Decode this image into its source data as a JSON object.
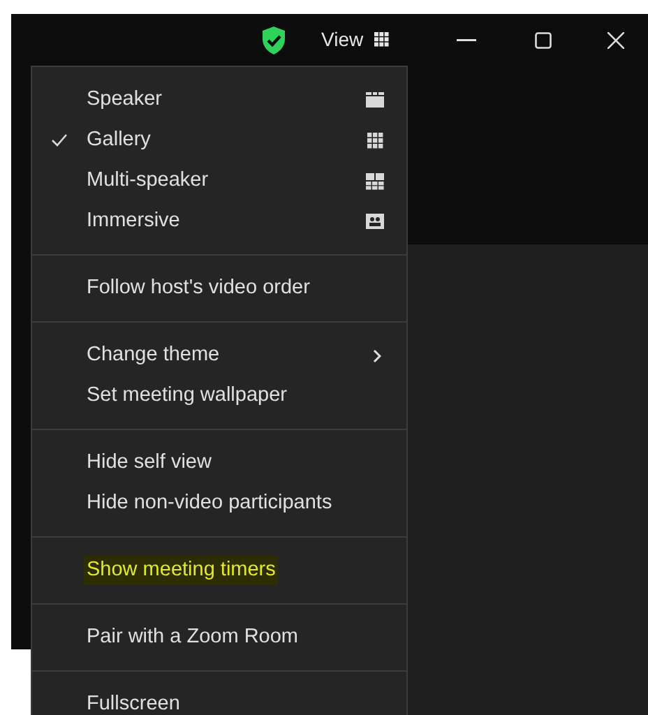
{
  "title_bar": {
    "view_label": "View"
  },
  "menu": {
    "groups": [
      [
        {
          "label": "Speaker",
          "checked": false,
          "kind": "speaker",
          "submenu": false,
          "highlighted": false
        },
        {
          "label": "Gallery",
          "checked": true,
          "kind": "gallery",
          "submenu": false,
          "highlighted": false
        },
        {
          "label": "Multi-speaker",
          "checked": false,
          "kind": "multi",
          "submenu": false,
          "highlighted": false
        },
        {
          "label": "Immersive",
          "checked": false,
          "kind": "immersive",
          "submenu": false,
          "highlighted": false
        }
      ],
      [
        {
          "label": "Follow host's video order",
          "checked": false,
          "submenu": false,
          "highlighted": false
        }
      ],
      [
        {
          "label": "Change theme",
          "checked": false,
          "submenu": true,
          "highlighted": false
        },
        {
          "label": "Set meeting wallpaper",
          "checked": false,
          "submenu": false,
          "highlighted": false
        }
      ],
      [
        {
          "label": "Hide self view",
          "checked": false,
          "submenu": false,
          "highlighted": false
        },
        {
          "label": "Hide non-video participants",
          "checked": false,
          "submenu": false,
          "highlighted": false
        }
      ],
      [
        {
          "label": "Show meeting timers",
          "checked": false,
          "submenu": false,
          "highlighted": true
        }
      ],
      [
        {
          "label": "Pair with a Zoom Room",
          "checked": false,
          "submenu": false,
          "highlighted": false
        }
      ],
      [
        {
          "label": "Fullscreen",
          "checked": false,
          "submenu": false,
          "highlighted": false
        }
      ]
    ]
  }
}
